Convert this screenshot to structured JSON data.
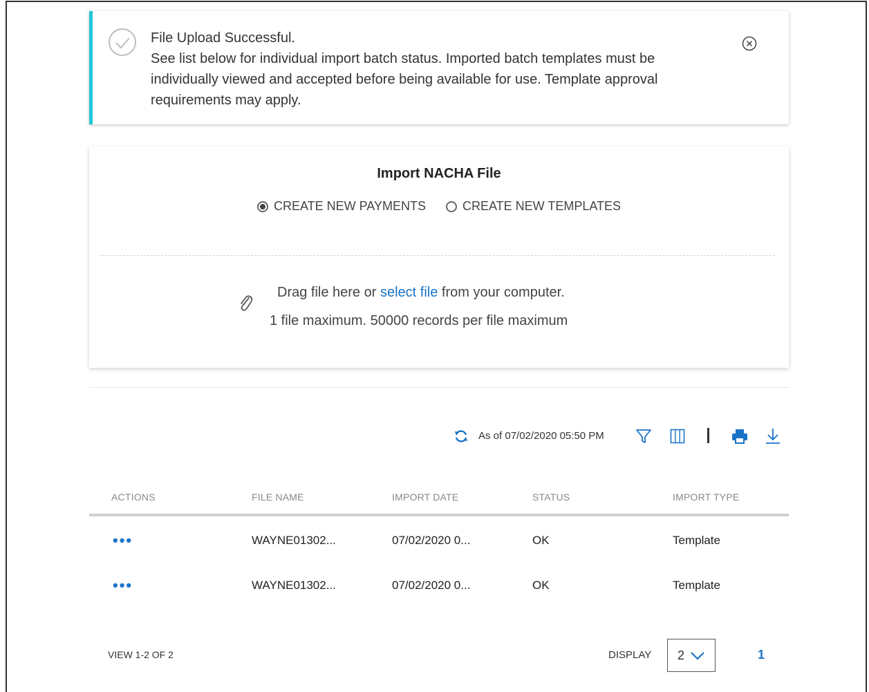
{
  "alert": {
    "title": "File Upload Successful.",
    "line1": "See list below for individual import batch status. Imported batch templates must be",
    "line2": "individually viewed and accepted before being available for use. Template approval",
    "line3": "requirements may apply.",
    "accent_color": "#22c7d6"
  },
  "import_card": {
    "title": "Import NACHA File",
    "options": [
      {
        "label": "CREATE NEW PAYMENTS",
        "selected": true
      },
      {
        "label": "CREATE NEW TEMPLATES",
        "selected": false
      }
    ],
    "drop_prefix": "Drag file here or ",
    "drop_link": "select file",
    "drop_suffix": " from your computer.",
    "limits": "1 file maximum. 50000 records per file maximum"
  },
  "toolbar": {
    "as_of": "As of 07/02/2020 05:50 PM",
    "accent_color": "#1a73c7"
  },
  "table": {
    "headers": [
      "ACTIONS",
      "FILE NAME",
      "IMPORT DATE",
      "STATUS",
      "IMPORT TYPE"
    ],
    "rows": [
      {
        "actions": "•••",
        "file_name": "WAYNE01302...",
        "import_date": "07/02/2020 0...",
        "status": "OK",
        "import_type": "Template"
      },
      {
        "actions": "•••",
        "file_name": "WAYNE01302...",
        "import_date": "07/02/2020 0...",
        "status": "OK",
        "import_type": "Template"
      }
    ]
  },
  "footer": {
    "view_count": "VIEW 1-2 OF 2",
    "display_label": "DISPLAY",
    "display_value": "2",
    "current_page": "1"
  }
}
